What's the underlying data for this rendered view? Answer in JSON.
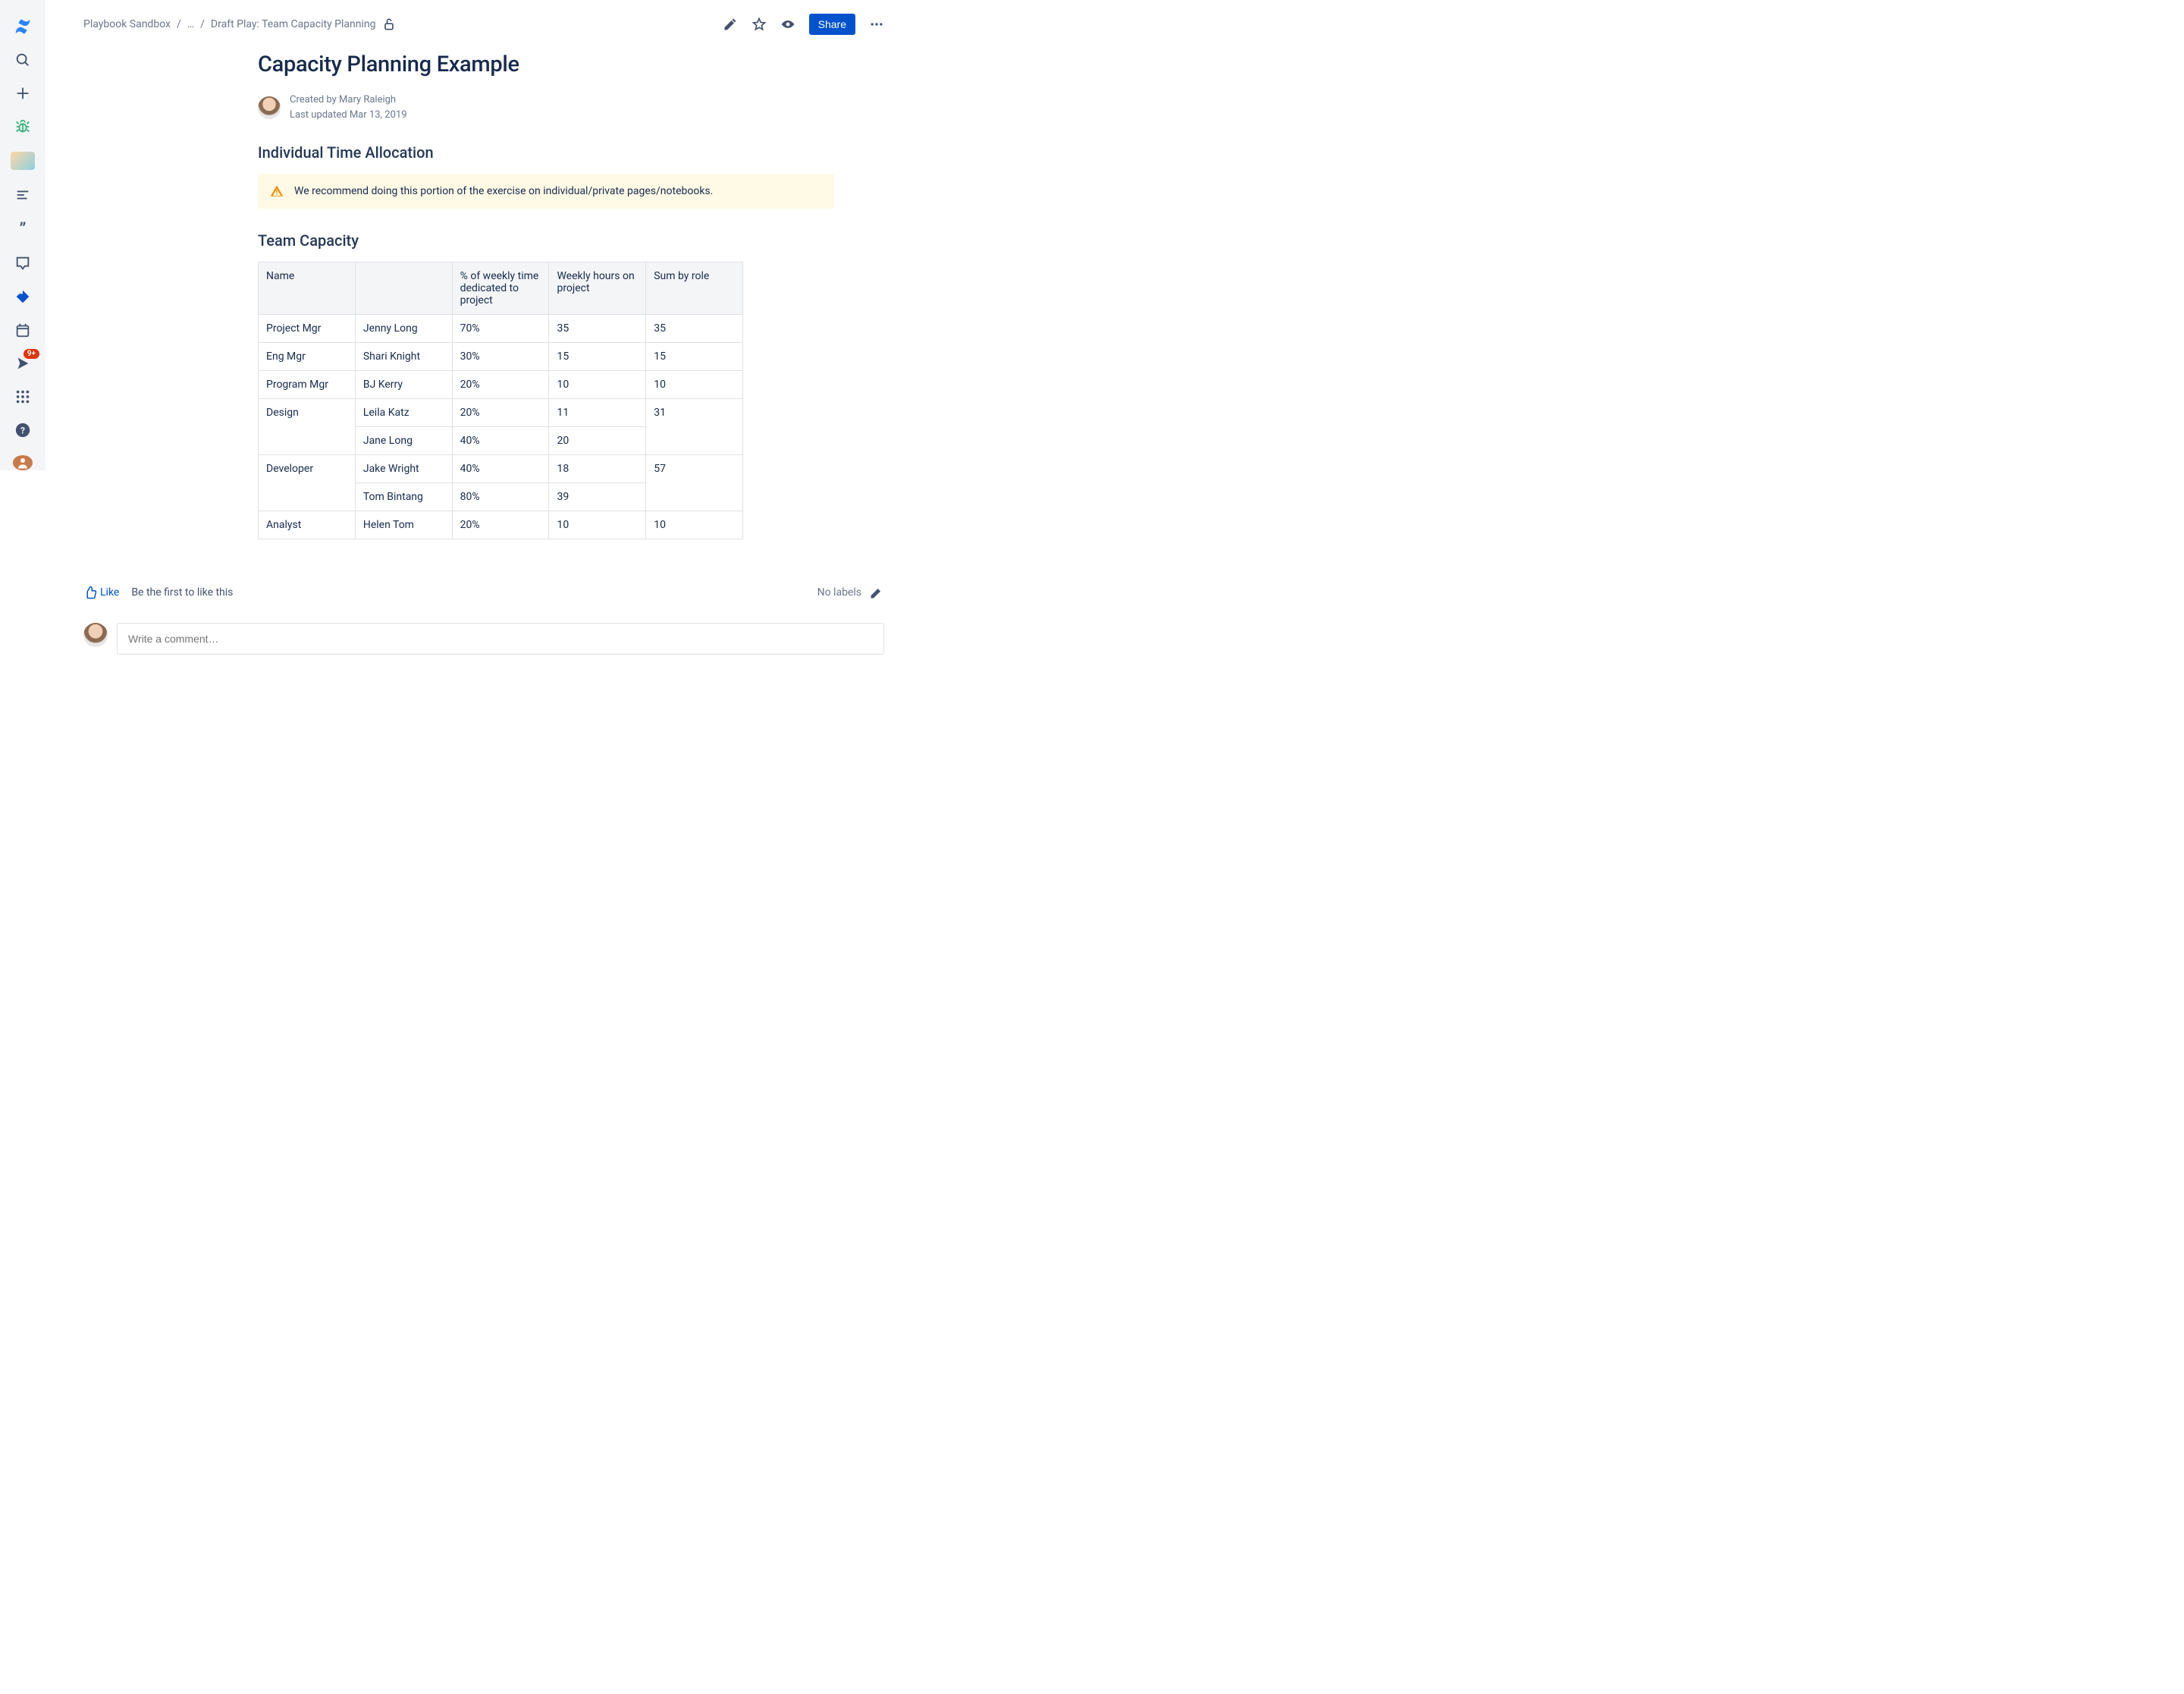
{
  "sidebar": {
    "notification_badge": "9+"
  },
  "breadcrumb": {
    "root": "Playbook Sandbox",
    "ellipsis": "…",
    "current": "Draft Play: Team Capacity Planning"
  },
  "actions": {
    "share_label": "Share"
  },
  "page": {
    "title": "Capacity Planning Example",
    "created_by": "Created by Mary Raleigh",
    "updated": "Last updated Mar 13, 2019"
  },
  "sections": {
    "individual_title": "Individual Time Allocation",
    "info_panel": "We recommend doing this portion of the exercise on individual/private pages/notebooks.",
    "team_title": "Team Capacity"
  },
  "table": {
    "headers": {
      "name": "Name",
      "blank": "",
      "percent": "% of weekly time dedicated to project",
      "hours": "Weekly hours on project",
      "sum": "Sum by role"
    },
    "rows": {
      "r0": {
        "role": "Project Mgr",
        "person": "Jenny Long",
        "percent": "70%",
        "hours": "35",
        "sum": "35"
      },
      "r1": {
        "role": "Eng Mgr",
        "person": "Shari Knight",
        "percent": "30%",
        "hours": "15",
        "sum": "15"
      },
      "r2": {
        "role": "Program Mgr",
        "person": "BJ Kerry",
        "percent": "20%",
        "hours": "10",
        "sum": "10"
      },
      "r3": {
        "role": "Design",
        "person": "Leila Katz",
        "percent": "20%",
        "hours": "11",
        "sum": "31"
      },
      "r4": {
        "person": "Jane Long",
        "percent": "40%",
        "hours": "20"
      },
      "r5": {
        "role": "Developer",
        "person": "Jake Wright",
        "percent": "40%",
        "hours": "18",
        "sum": "57"
      },
      "r6": {
        "person": "Tom Bintang",
        "percent": "80%",
        "hours": "39"
      },
      "r7": {
        "role": "Analyst",
        "person": "Helen Tom",
        "percent": "20%",
        "hours": "10",
        "sum": "10"
      }
    }
  },
  "footer": {
    "like_label": "Like",
    "like_prompt": "Be the first to like this",
    "no_labels": "No labels",
    "comment_placeholder": "Write a comment…"
  }
}
